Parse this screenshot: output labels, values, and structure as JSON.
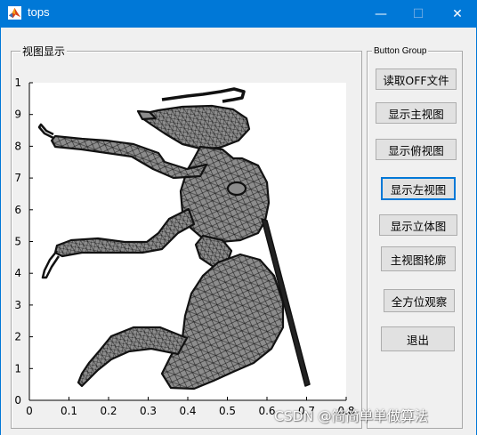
{
  "window": {
    "title": "tops",
    "minimize_glyph": "—",
    "maximize_glyph": "☐",
    "close_glyph": "✕"
  },
  "view_panel": {
    "title": "视图显示"
  },
  "button_group": {
    "title": "Button Group",
    "buttons": [
      {
        "label": "读取OFF文件"
      },
      {
        "label": "显示主视图"
      },
      {
        "label": "显示俯视图"
      },
      {
        "label": "显示左视图",
        "focused": true
      },
      {
        "label": "显示立体图"
      },
      {
        "label": "主视图轮廓"
      },
      {
        "label": "全方位观察"
      },
      {
        "label": "退出"
      }
    ]
  },
  "plot": {
    "x_ticks": [
      "0",
      "0.1",
      "0.2",
      "0.3",
      "0.4",
      "0.5",
      "0.6",
      "0.7",
      "0.8"
    ],
    "y_ticks": [
      "0",
      "1",
      "2",
      "3",
      "4",
      "5",
      "6",
      "7",
      "8",
      "9",
      "1"
    ],
    "mesh_fill": "#8c8c8c",
    "mesh_edge": "#111111",
    "subject": "ant-mesh"
  },
  "watermark": "CSDN @简简单单做算法",
  "colors": {
    "titlebar": "#0078d7",
    "window_bg": "#f0f0f0",
    "button_bg": "#e1e1e1",
    "focus": "#0078d7"
  }
}
